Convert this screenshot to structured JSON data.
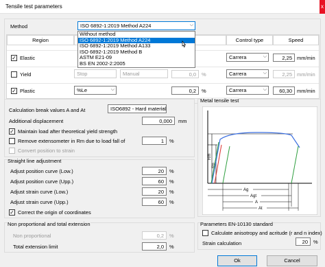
{
  "window": {
    "title": "Tensile test parameters",
    "close_glyph": "x"
  },
  "method": {
    "label": "Method",
    "selected": "ISO 6892-1:2019 Method A224",
    "options": [
      "Without method",
      "ISO 6892-1:2019 Method A224",
      "ISO 6892-1:2019 Method A133",
      "ISO 6892-1:2019 Method B",
      "ASTM E21-09",
      "BS EN 2002-2:2005"
    ]
  },
  "regions_table": {
    "headers": {
      "region": "Region",
      "control_type": "Control type",
      "speed": "Speed"
    },
    "rows": [
      {
        "name": "Elastic",
        "checked": true,
        "param": "",
        "control": "Carrera",
        "speed": "2,25",
        "unit": "mm/min",
        "disabled": false
      },
      {
        "name": "Yield",
        "checked": false,
        "param": "Stop",
        "manual": "Manual",
        "value": "0,0",
        "value_unit": "%",
        "control": "Carrera",
        "speed": "2,25",
        "unit": "mm/min",
        "disabled": true
      },
      {
        "name": "Plastic",
        "checked": true,
        "param": "%Le",
        "value": "0,2",
        "value_unit": "%",
        "control": "Carrera",
        "speed": "60,30",
        "unit": "mm/min",
        "disabled": false
      }
    ]
  },
  "calc": {
    "break_label": "Calculation break values A and At",
    "break_value": "ISO6892 - Hard material",
    "disp_label": "Additional displacement",
    "disp_value": "0,000",
    "disp_unit": "mm",
    "maintain_label": "Maintain load after theoretical yield strength",
    "remove_label": "Remove extensometer in Rm due to load fall of",
    "remove_value": "1",
    "remove_unit": "%",
    "convert_label": "Convert position to strain"
  },
  "straight": {
    "title": "Straight line adjustment",
    "rows": [
      {
        "label": "Adjust position curve (Low.)",
        "value": "20",
        "unit": "%"
      },
      {
        "label": "Adjust position curve (Upp.)",
        "value": "60",
        "unit": "%"
      },
      {
        "label": "Adjust strain curve (Low.)",
        "value": "20",
        "unit": "%"
      },
      {
        "label": "Adjust strain curve (Upp.)",
        "value": "60",
        "unit": "%"
      }
    ],
    "correct_label": "Correct the origin of coordinates"
  },
  "nonprop": {
    "title": "Non proportional and total extension",
    "np_label": "Non proportional",
    "np_value": "0,2",
    "np_unit": "%",
    "te_label": "Total extension limit",
    "te_value": "2,0",
    "te_unit": "%"
  },
  "metal": {
    "title": "Metal tensile test",
    "labels": {
      "rm": "Rm",
      "rp": "Rp",
      "ag": "Ag",
      "agt": "Agt",
      "a": "A",
      "at": "At"
    }
  },
  "en10130": {
    "title": "Parameters EN-10130 standard",
    "anis_label": "Calculate anisotropy and acritude (r and n index)",
    "strain_label": "Strain calculation",
    "strain_value": "20",
    "strain_unit": "%"
  },
  "buttons": {
    "ok": "Ok",
    "cancel": "Cancel"
  },
  "colors": {
    "accent": "#0078d7",
    "close": "#e81123",
    "curve": "#3b6fe0",
    "curve_green": "#2e9e3e",
    "curve_red": "#d93030"
  }
}
